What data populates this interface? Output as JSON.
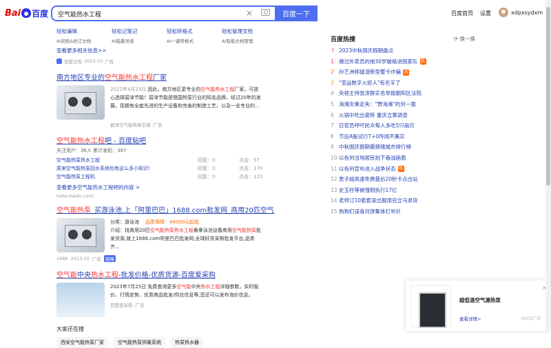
{
  "header": {
    "logo_left": "Bai",
    "logo_right": "百度",
    "query": "空气能热水工程",
    "search_btn": "百度一下",
    "home": "百度首页",
    "settings": "设置",
    "username": "xdpxsydxm"
  },
  "tools": [
    {
      "name": "轻松编辑",
      "desc": "AI润色&修订文档"
    },
    {
      "name": "轻松记笔记",
      "desc": "AI脑暴灵感"
    },
    {
      "name": "轻松转格式",
      "desc": "AI一键转格式"
    },
    {
      "name": "轻松管理文档",
      "desc": "AI智能文档管理"
    }
  ],
  "more_info": "查看更多相关信息>>",
  "source1": {
    "name": "百度文库",
    "date": "2023-10",
    "ad": "广告"
  },
  "r2": {
    "t1": "南方地区专业的",
    "t2": "空气能热水工程",
    "t3": "厂家",
    "date": "2022年4月23日",
    "s1": "因此，南方地区更专业的",
    "s2": "空气能热水工程",
    "s3": "厂家，可放心选择碧涞节能！碧涞节能是我国热泵行业的知名品牌，经过20年的发展，现拥有全套先进的生产设备和完善的制造工艺，以及一支专业的...",
    "src": "碧涞空气能热泵空调",
    "ad": "广告"
  },
  "r3": {
    "t1": "空气能热水工程",
    "t2": "吧 - 百度贴吧",
    "stats": "关注用户：36人   累计发贴：387",
    "rows": [
      {
        "title": "空气能热泵热水工程",
        "reply": "回复：0",
        "click": "点击：57"
      },
      {
        "title": "原来空气能热泵回水系统也有这么多小知识!",
        "reply": "回复：0",
        "click": "点击：170"
      },
      {
        "title": "空气能热泵工程机",
        "reply": "回复：0",
        "click": "点击：123"
      }
    ],
    "more": "查看更多空气能热水工程吧的内容 >",
    "url": "tieba.baidu.com/"
  },
  "r4": {
    "t1": "空气能热泵",
    "t2": "_买游泳池,上「阿里巴巴」1688.com批发网_商用20匹空气",
    "cat": "分类：游泳池",
    "price": "品质保障：46000元起批",
    "s1": "介绍：找商用20匹",
    "s2": "空气能热泵热水工程",
    "s3": "桑拿泳池设备商用",
    "s4": "空气能热泵",
    "s5": "批发货源,就上1688.com阿里巴巴批发网,全球好货采购批发平台,品类齐...",
    "src": "1688",
    "date": "2023-10",
    "ad": "广告",
    "v": "保障"
  },
  "r5": {
    "t1": "空气能",
    "t2": "中央",
    "t3": "热水工程",
    "t4": "-批发价格-优质货源-百度爱采购",
    "s1": "2023年7月25日 免费查询更多",
    "s2": "空气能",
    "s3": "中央",
    "s4": "热水工程",
    "s5": "详细参数，实时报价、行情走势、优质商品批发/供应信息等,您还可以发布询价信息。",
    "src": "百度爱采购",
    "ad": "广告"
  },
  "related": {
    "title": "大家还在搜",
    "items": [
      "西安空气能热泵厂家",
      "空气能热泵供暖系统",
      "热泵热水器"
    ]
  },
  "hot": {
    "title": "百度热搜",
    "switch": "换一换",
    "items": [
      {
        "n": "",
        "t": "2023中秋国庆假期盘点",
        "tag": ""
      },
      {
        "n": "1",
        "t": "做过外卖员的他30岁破格进国家队",
        "tag": "热"
      },
      {
        "n": "2",
        "t": "孙艺洲称缝渣新型蟹卡诈骗",
        "tag": "热"
      },
      {
        "n": "3",
        "t": "\"亚运数字火炬人\"有名字了",
        "tag": ""
      },
      {
        "n": "4",
        "t": "央视主持张泽群实名举报朝阳区法院",
        "tag": ""
      },
      {
        "n": "5",
        "t": "海滩女秦走失：\"野海滩\"的另一面",
        "tag": ""
      },
      {
        "n": "6",
        "t": "火锅中吃出瓷砖 重庆立案调查",
        "tag": ""
      },
      {
        "n": "7",
        "t": "日官员呼吁民众每人多吃5只扇贝",
        "tag": ""
      },
      {
        "n": "8",
        "t": "节后A股试行T+0传闻不属实",
        "tag": ""
      },
      {
        "n": "9",
        "t": "中秋国庆假期最拥堵城市排行榜",
        "tag": ""
      },
      {
        "n": "10",
        "t": "以色列当地居民拍下巷战画面",
        "tag": ""
      },
      {
        "n": "11",
        "t": "以色列宣布进入战争状态",
        "tag": "热"
      },
      {
        "n": "12",
        "t": "男子超高速免费最后20秒卡点出站",
        "tag": ""
      },
      {
        "n": "13",
        "t": "史玉柱等被强制执行17亿",
        "tag": ""
      },
      {
        "n": "14",
        "t": "老师订10套套滚出服用完立马退货",
        "tag": ""
      },
      {
        "n": "15",
        "t": "狗狗们误食月饼集体打吊针",
        "tag": ""
      }
    ]
  },
  "ad": {
    "title": "超低温空气源热泵",
    "link": "查看详情>",
    "label": "360日广告",
    "close": "×"
  }
}
